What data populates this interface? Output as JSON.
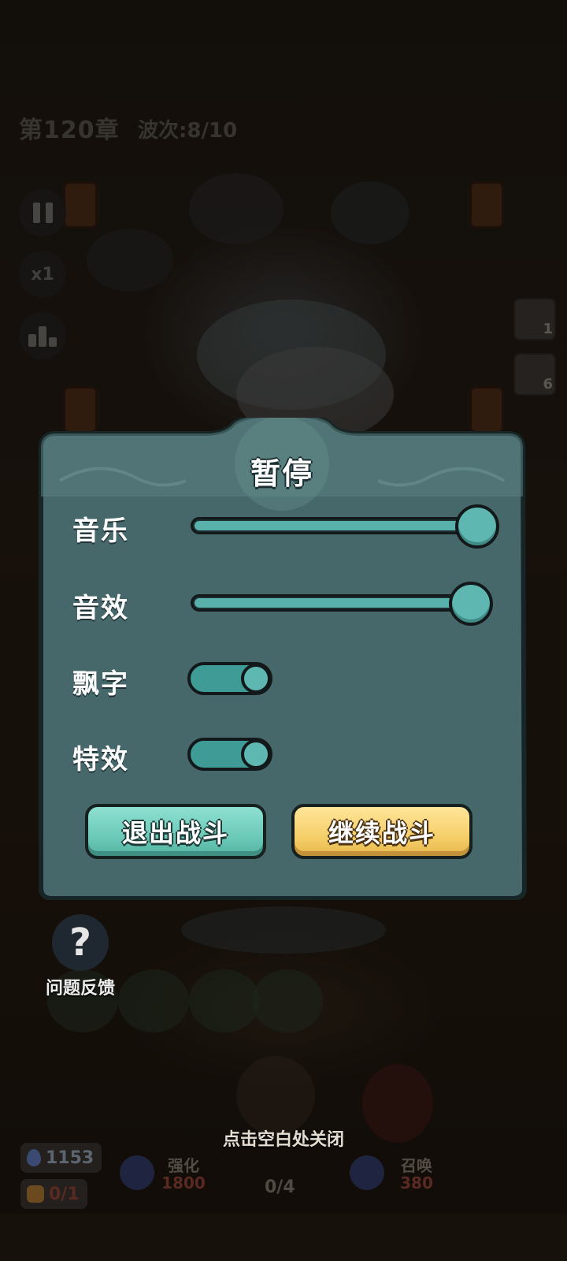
{
  "hud": {
    "chapter": "第120章",
    "wave": "波次:8/10",
    "speed_label": "x1",
    "side_cards": [
      {
        "count": "1"
      },
      {
        "count": "6"
      }
    ]
  },
  "pause_panel": {
    "title": "暂停",
    "music": {
      "label": "音乐",
      "level": 1.0
    },
    "sfx": {
      "label": "音效",
      "level": 1.0
    },
    "float_text": {
      "label": "飘字",
      "on": true
    },
    "effects": {
      "label": "特效",
      "on": true
    },
    "exit_button": "退出战斗",
    "continue_button": "继续战斗"
  },
  "feedback": {
    "label": "问题反馈",
    "icon": "question-icon"
  },
  "close_hint": "点击空白处关闭",
  "bottom": {
    "spirit_count": "1153",
    "bag_count": "0/1",
    "enhance": {
      "label": "强化",
      "cost": "1800"
    },
    "summon": {
      "label": "召唤",
      "cost": "380"
    },
    "unit_count": "0/4"
  },
  "colors": {
    "panel_teal": "#466a6c",
    "slider_fill": "#59b1ac",
    "exit_btn": "#6ccab9",
    "continue_btn": "#f6cf6a"
  }
}
